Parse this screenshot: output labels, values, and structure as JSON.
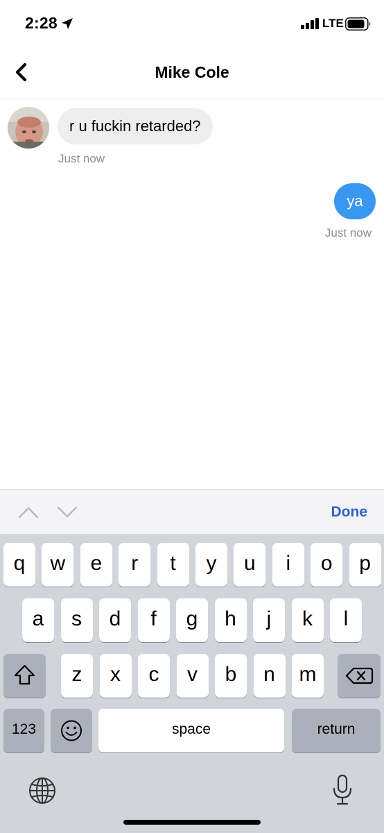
{
  "status_bar": {
    "time": "2:28",
    "network": "LTE"
  },
  "header": {
    "title": "Mike Cole"
  },
  "messages": [
    {
      "direction": "incoming",
      "text": "r u fuckin retarded?",
      "timestamp": "Just now"
    },
    {
      "direction": "outgoing",
      "text": "ya",
      "timestamp": "Just now"
    }
  ],
  "accessory": {
    "done_label": "Done"
  },
  "keyboard": {
    "row1": [
      "q",
      "w",
      "e",
      "r",
      "t",
      "y",
      "u",
      "i",
      "o",
      "p"
    ],
    "row2": [
      "a",
      "s",
      "d",
      "f",
      "g",
      "h",
      "j",
      "k",
      "l"
    ],
    "row3": [
      "z",
      "x",
      "c",
      "v",
      "b",
      "n",
      "m"
    ],
    "numbers_label": "123",
    "space_label": "space",
    "return_label": "return"
  },
  "colors": {
    "accent": "#3897f0",
    "done": "#2c62c9",
    "keyboard_bg": "#d2d4db"
  }
}
